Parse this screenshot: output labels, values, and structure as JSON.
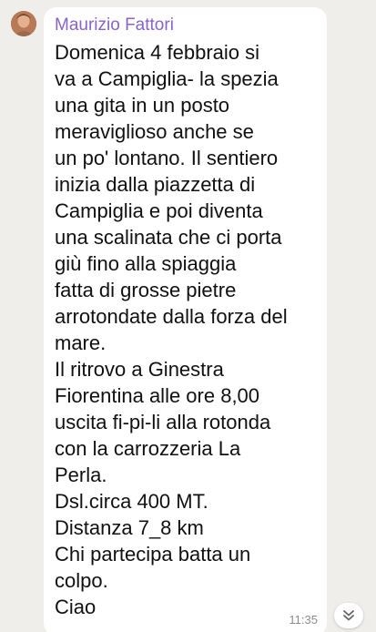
{
  "message": {
    "sender": "Maurizio Fattori",
    "lines": [
      "Domenica 4 febbraio si",
      "va a Campiglia- la spezia",
      "una gita in un posto",
      "meraviglioso anche se",
      "un po' lontano. Il sentiero",
      "inizia dalla piazzetta di",
      "Campiglia e poi diventa",
      "una scalinata che ci porta",
      "giù fino alla spiaggia",
      "fatta di grosse pietre",
      "arrotondate dalla forza del",
      "mare.",
      "Il ritrovo a Ginestra",
      "Fiorentina alle ore 8,00",
      "uscita fi-pi-li alla rotonda",
      "con la carrozzeria La",
      "Perla.",
      "Dsl.circa 400 MT.",
      "Distanza 7_8 km",
      "Chi partecipa batta un",
      "colpo.",
      "Ciao"
    ],
    "time": "11:35"
  },
  "icons": {
    "avatar": "user-avatar",
    "scroll_down": "chevron-double-down-icon"
  },
  "colors": {
    "background": "#efeeea",
    "bubble": "#ffffff",
    "sender": "#8a63c8",
    "text": "#111111",
    "time": "#8c8c8c"
  }
}
